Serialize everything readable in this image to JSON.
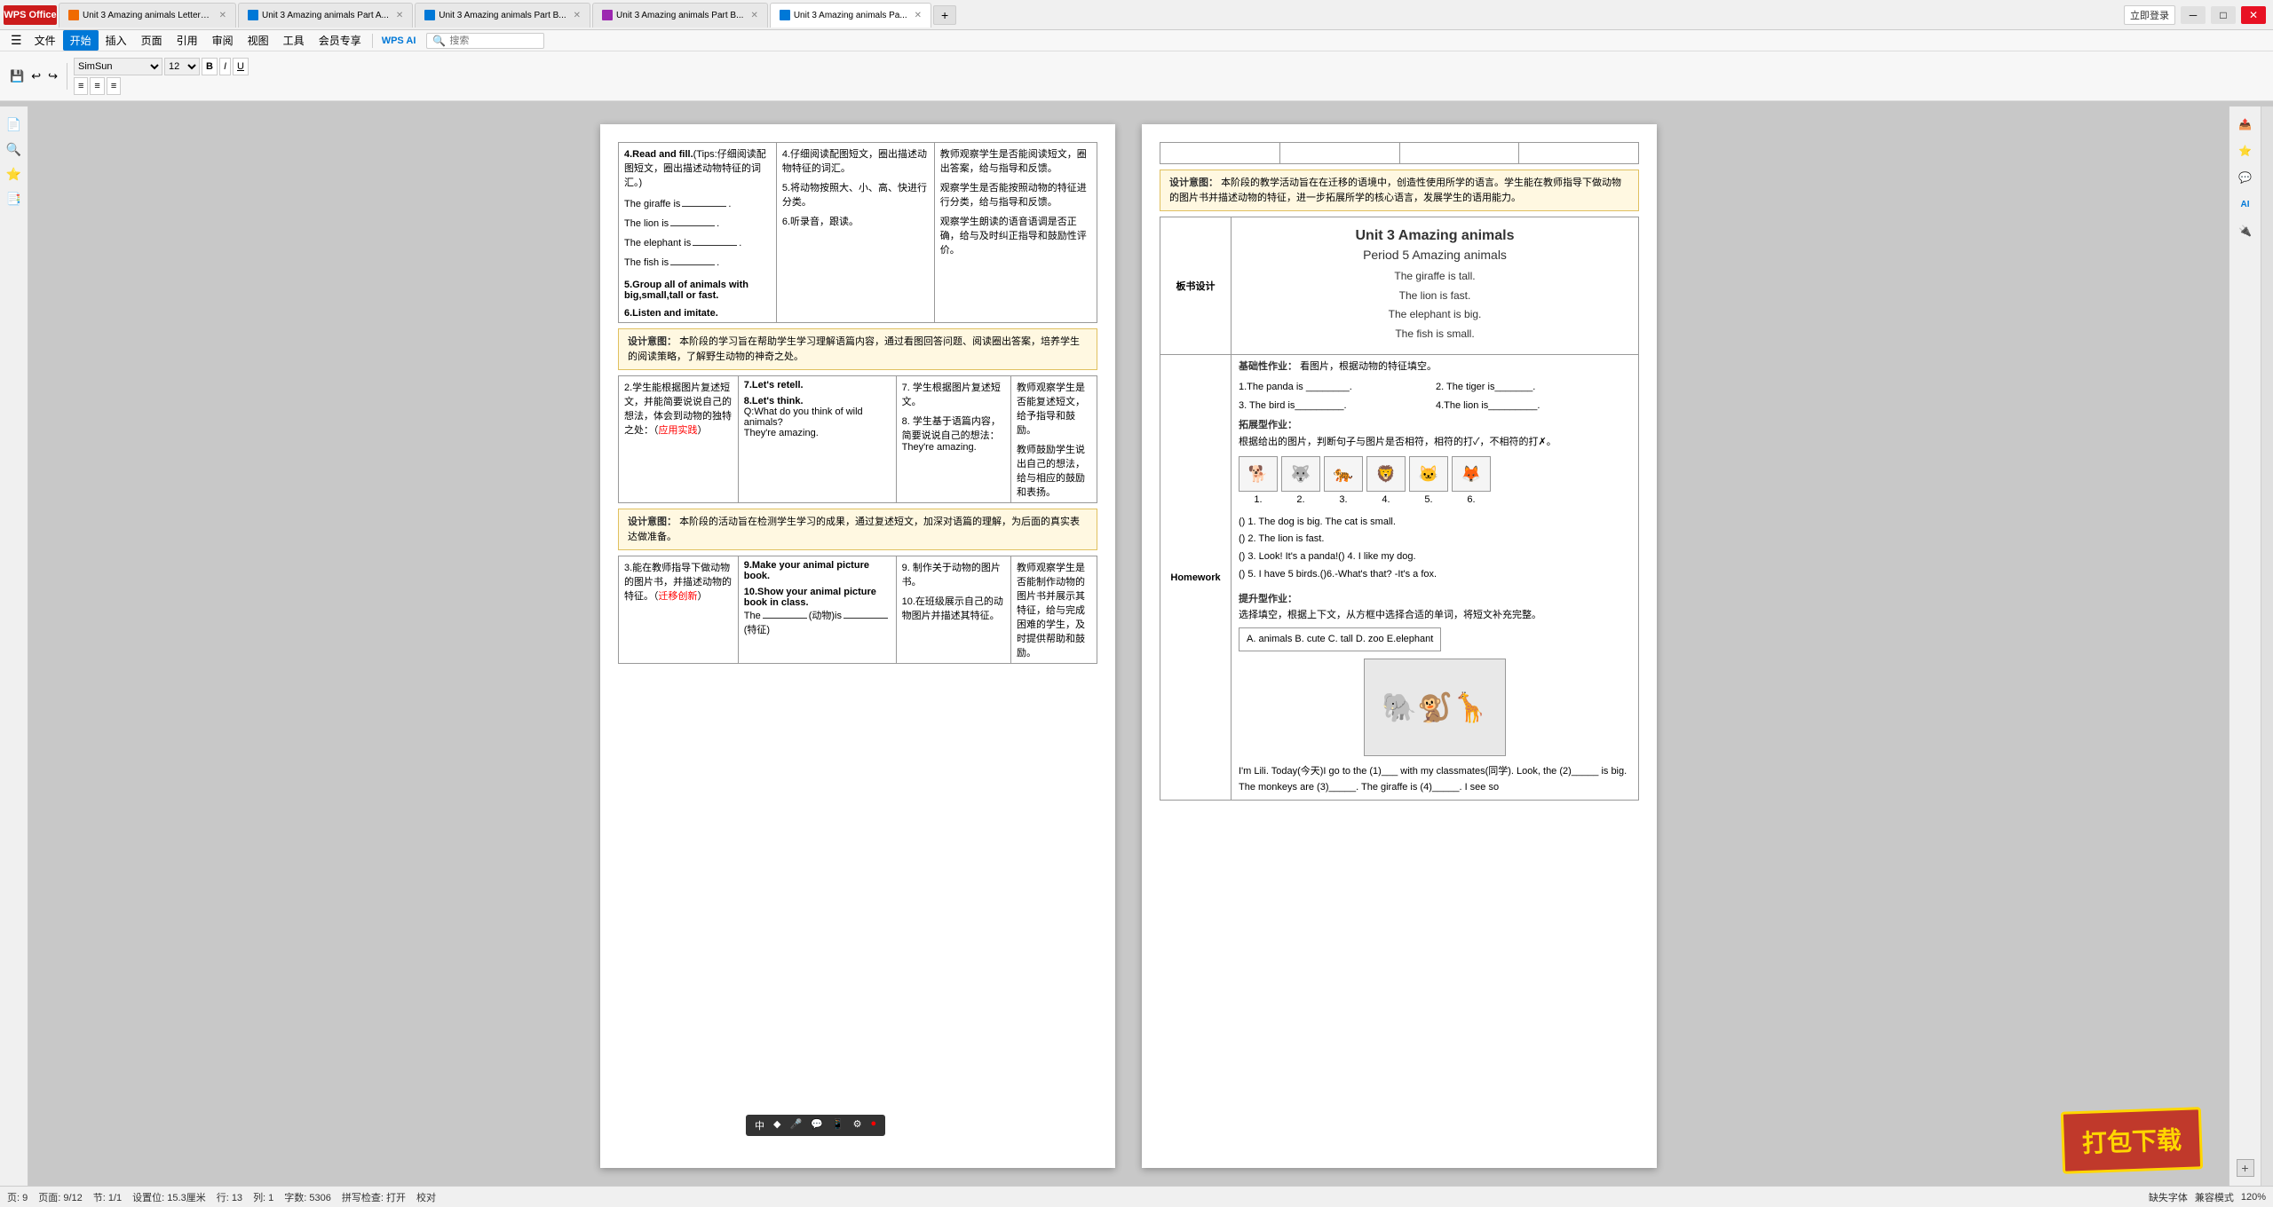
{
  "titlebar": {
    "wps_label": "WPS Office",
    "tabs": [
      {
        "label": "Unit 3 Amazing animals Letters...",
        "icon": "orange",
        "active": false
      },
      {
        "label": "Unit 3 Amazing animals Part A...",
        "icon": "blue",
        "active": false
      },
      {
        "label": "Unit 3 Amazing animals Part B...",
        "icon": "blue",
        "active": false
      },
      {
        "label": "Unit 3 Amazing animals Part B...",
        "icon": "purple",
        "active": false
      },
      {
        "label": "Unit 3 Amazing animals Pa...",
        "icon": "blue",
        "active": true
      }
    ],
    "btn_min": "─",
    "btn_max": "□",
    "btn_close": "✕",
    "login_label": "立即登录"
  },
  "ribbon": {
    "menus": [
      "文件",
      "插入",
      "页面",
      "引用",
      "审阅",
      "视图",
      "工具",
      "会员专享"
    ],
    "active_menu": "开始",
    "wps_ai": "WPS AI",
    "search_placeholder": "搜索"
  },
  "statusbar": {
    "page_info": "页: 9",
    "page_count": "页面: 9/12",
    "section": "节: 1/1",
    "location": "设置位: 15.3厘米",
    "col": "行: 13",
    "row": "列: 1",
    "word_count": "字数: 5306",
    "spell_check": "拼写检查: 打开",
    "proofread": "校对",
    "missing_font": "缺失字体",
    "compatibility": "兼容模式",
    "zoom": "120%"
  },
  "left_page": {
    "rows": [
      {
        "col1": "4.Read and fill.(Tips:仔细阅读配图短文，圈出描述动物特征的词汇。)\n\nThe giraffe is______.\n\nThe lion is______.\n\nThe elephant is_____.\n\nThe fish is_____.\n\n5.Group all of animals with big,small,tall or fast.\n\n6.Listen and imitate.",
        "col2": "4.仔细阅读配图短文，圈出描述动物特征的词汇。\n\n5.将动物按照大、小、高、快进行分类。\n\n6.听录音，跟读。",
        "col3": "教师观察学生是否能阅读短文，圈出答案，给与指导和反馈。\n\n观察学生是否能按照动物的特征进行分类，给与指导和反馈。\n\n观察学生朗读的语音语调是否正确，给与及时纠正指导和鼓励性评价。"
      }
    ],
    "design_note1": {
      "label": "设计意图：",
      "text": "本阶段的学习旨在帮助学生学习理解语篇内容，通过看图回答问题、阅读圈出答案，培养学生的阅读策略，了解野生动物的神奇之处。"
    },
    "rows2": [
      {
        "col1": "2.学生能根据图片复述短文，并能简要说说自己的想法，体会到动物的独特之处：（应用实践）",
        "col2": "7.Let's retell.\n\n8.Let's think.\nQ:What do you think of wild animals?\nThey're amazing.",
        "col3": "7. 学生根据图片复述短文。\n\n8. 学生基于语篇内容，简要说说自己的想法：They're amazing.",
        "col4": "教师观察学生是否能复述短文，给予指导和鼓励。\n\n教师鼓励学生说出自己的想法，给与相应的鼓励和表扬。"
      }
    ],
    "design_note2": {
      "label": "设计意图：",
      "text": "本阶段的活动旨在检测学生学习的成果，通过复述短文，加深对语篇的理解，为后面的真实表达做准备。"
    },
    "rows3": [
      {
        "col1": "3.能在教师指导下做动物的图片书，并描述动物的特征。（迁移创新）",
        "col2": "9.Make your animal picture book.\n10.Show your animal picture book in class.\nThe_____(动物)is____(特征)",
        "col3": "9. 制作关于动物的图片书。\n10.在班级展示自己的动物图片并描述其特征。",
        "col4": "教师观察学生是否能制作动物的图片书并展示其特征，给与完成困难的学生，及时提供帮助和鼓励。"
      }
    ]
  },
  "right_page": {
    "top_headers": [
      "",
      "",
      "",
      ""
    ],
    "design_note_right": {
      "label": "设计意图：",
      "text": "本阶段的教学活动旨在在迁移的语境中，创造性使用所学的语言。学生能在教师指导下做动物的图片书并描述动物的特征，进一步拓展所学的核心语言，发展学生的语用能力。"
    },
    "board_label": "板书设计",
    "unit_title": "Unit 3 Amazing animals",
    "period_title": "Period 5 Amazing animals",
    "sentences": [
      "The giraffe is tall.",
      "The lion is fast.",
      "The elephant is big.",
      "The fish is small."
    ],
    "homework_label": "Homework",
    "homework_basic_title": "基础性作业：",
    "homework_basic_desc": "看图片，根据动物的特征填空。",
    "homework_basic_items": [
      "1.The panda is ________.",
      "2. The tiger is_______.",
      "3. The bird is_________.",
      "4.The lion is_________."
    ],
    "homework_expand_title": "拓展型作业：",
    "homework_expand_desc": "根据给出的图片，判断句子与图片是否相符，相符的打✓，不相符的打✗。",
    "animal_icons": [
      "🐕",
      "🐺",
      "🐅",
      "🦁",
      "🐱",
      "🦊"
    ],
    "animal_numbers": [
      "1.",
      "2.",
      "3.",
      "4.",
      "5.",
      "6."
    ],
    "expand_sentences": [
      "() 1. The dog is big. The cat is small.",
      "() 2. The lion is fast.",
      "() 3. Look! It's a panda!() 4. I like my dog.",
      "() 5. I have 5 birds.()6.-What's that? -It's a fox."
    ],
    "homework_improve_title": "提升型作业：",
    "homework_improve_desc": "选择填空，根据上下文，从方框中选择合适的单词，将短文补充完整。",
    "word_choices": "A. animals  B. cute   C. tall   D. zoo  E.elephant",
    "story_text": "I'm Lili. Today(今天)I go to the (1)___ with my classmates(同学). Look, the (2)_____ is big. The monkeys are (3)_____. The giraffe is (4)_____. I see so",
    "story_animal_emoji": "🐘🐒🦒",
    "wps_toolbar_items": [
      "中",
      "♦",
      "🎤",
      "💬",
      "📱",
      "⚙",
      "🔴"
    ]
  },
  "download_banner": {
    "text": "打包下载"
  }
}
